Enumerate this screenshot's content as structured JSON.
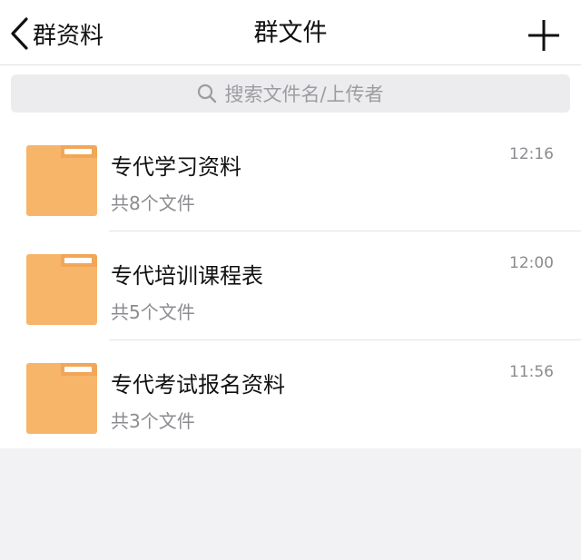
{
  "nav": {
    "back_label": "群资料",
    "title": "群文件",
    "back_icon": "chevron-left-icon",
    "add_icon": "plus-icon"
  },
  "search": {
    "placeholder": "搜索文件名/上传者",
    "icon": "search-icon"
  },
  "folders": [
    {
      "name": "专代学习资料",
      "count_text": "共8个文件",
      "time": "12:16"
    },
    {
      "name": "专代培训课程表",
      "count_text": "共5个文件",
      "time": "12:00"
    },
    {
      "name": "专代考试报名资料",
      "count_text": "共3个文件",
      "time": "11:56"
    }
  ],
  "colors": {
    "folder": "#f7b56a",
    "background": "#f2f2f4",
    "search_bg": "#ececee",
    "secondary_text": "#8c8c90"
  }
}
